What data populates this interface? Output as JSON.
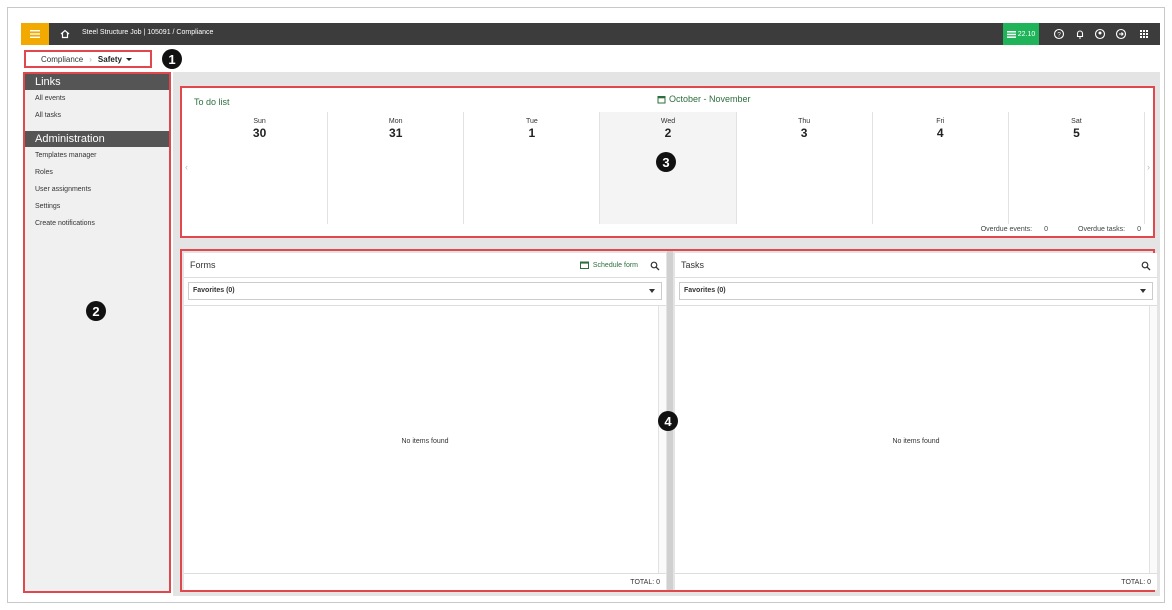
{
  "topbar": {
    "breadcrumb": "Steel Structure Job | 105091  /  Compliance",
    "version": "22.10",
    "icons": [
      "menu-icon",
      "home-icon",
      "help-icon",
      "bell-icon",
      "user-icon",
      "logout-icon",
      "apps-icon"
    ]
  },
  "breadcrumb": {
    "parent": "Compliance",
    "current": "Safety"
  },
  "callouts": [
    "1",
    "2",
    "3",
    "4"
  ],
  "sidebar": {
    "sections": [
      {
        "title": "Links",
        "items": [
          "All events",
          "All tasks"
        ]
      },
      {
        "title": "Administration",
        "items": [
          "Templates manager",
          "Roles",
          "User assignments",
          "Settings",
          "Create notifications"
        ]
      }
    ]
  },
  "todo": {
    "title": "To do list",
    "month": "October - November",
    "days": [
      {
        "name": "Sun",
        "date": "30"
      },
      {
        "name": "Mon",
        "date": "31"
      },
      {
        "name": "Tue",
        "date": "1"
      },
      {
        "name": "Wed",
        "date": "2"
      },
      {
        "name": "Thu",
        "date": "3"
      },
      {
        "name": "Fri",
        "date": "4"
      },
      {
        "name": "Sat",
        "date": "5"
      }
    ],
    "overdue_events_label": "Overdue events:",
    "overdue_events": "0",
    "overdue_tasks_label": "Overdue tasks:",
    "overdue_tasks": "0"
  },
  "forms": {
    "title": "Forms",
    "schedule_label": "Schedule form",
    "filter": "Favorites (0)",
    "empty": "No items found",
    "total": "TOTAL:  0"
  },
  "tasks": {
    "title": "Tasks",
    "filter": "Favorites (0)",
    "empty": "No items found",
    "total": "TOTAL:  0"
  }
}
